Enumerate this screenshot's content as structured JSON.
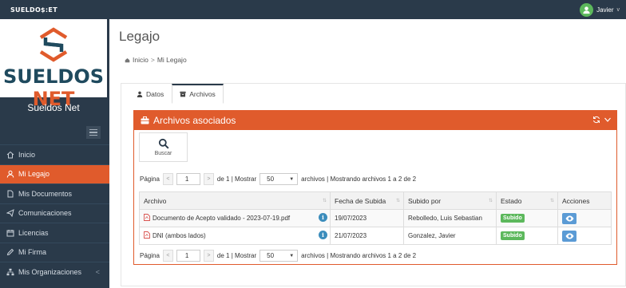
{
  "topbar": {
    "brand": "SUELDO$:ET",
    "user_name": "Javier",
    "caret": "v"
  },
  "sidebar": {
    "logo_word1": "SUELDOS",
    "logo_word2": "NET",
    "title": "Sueldos Net",
    "items": [
      {
        "label": "Inicio",
        "icon": "home-icon"
      },
      {
        "label": "Mi Legajo",
        "icon": "user-icon",
        "active": true
      },
      {
        "label": "Mis Documentos",
        "icon": "file-icon"
      },
      {
        "label": "Comunicaciones",
        "icon": "paper-plane-icon"
      },
      {
        "label": "Licencias",
        "icon": "calendar-icon"
      },
      {
        "label": "Mi Firma",
        "icon": "pen-icon"
      },
      {
        "label": "Mis Organizaciones",
        "icon": "sitemap-icon",
        "arrow": "<"
      }
    ]
  },
  "page": {
    "title": "Legajo",
    "breadcrumb": {
      "home": "Inicio",
      "sep": ">",
      "current": "Mi Legajo"
    }
  },
  "tabs": [
    {
      "label": "Datos",
      "icon": "user-icon"
    },
    {
      "label": "Archivos",
      "icon": "archive-icon",
      "active": true
    }
  ],
  "box": {
    "title": "Archivos asociados",
    "search_label": "Buscar",
    "pager": {
      "page_label": "Página",
      "prev": "<",
      "next": ">",
      "page_value": "1",
      "of_text": "de 1 | Mostrar",
      "page_size": "50",
      "summary": "archivos | Mostrando archivos 1 a 2 de 2"
    },
    "columns": [
      "Archivo",
      "Fecha de Subida",
      "Subido por",
      "Estado",
      "Acciones"
    ],
    "rows": [
      {
        "archivo": "Documento de Acepto validado - 2023-07-19.pdf",
        "fecha": "19/07/2023",
        "subido_por": "Rebolledo, Luis Sebastian",
        "estado": "Subido"
      },
      {
        "archivo": "DNI (ambos lados)",
        "fecha": "21/07/2023",
        "subido_por": "Gonzalez, Javier",
        "estado": "Subido"
      }
    ]
  },
  "colors": {
    "accent": "#e05b2c",
    "dark": "#2a3a4a",
    "success": "#5cb85c",
    "info": "#3c8dbc"
  }
}
